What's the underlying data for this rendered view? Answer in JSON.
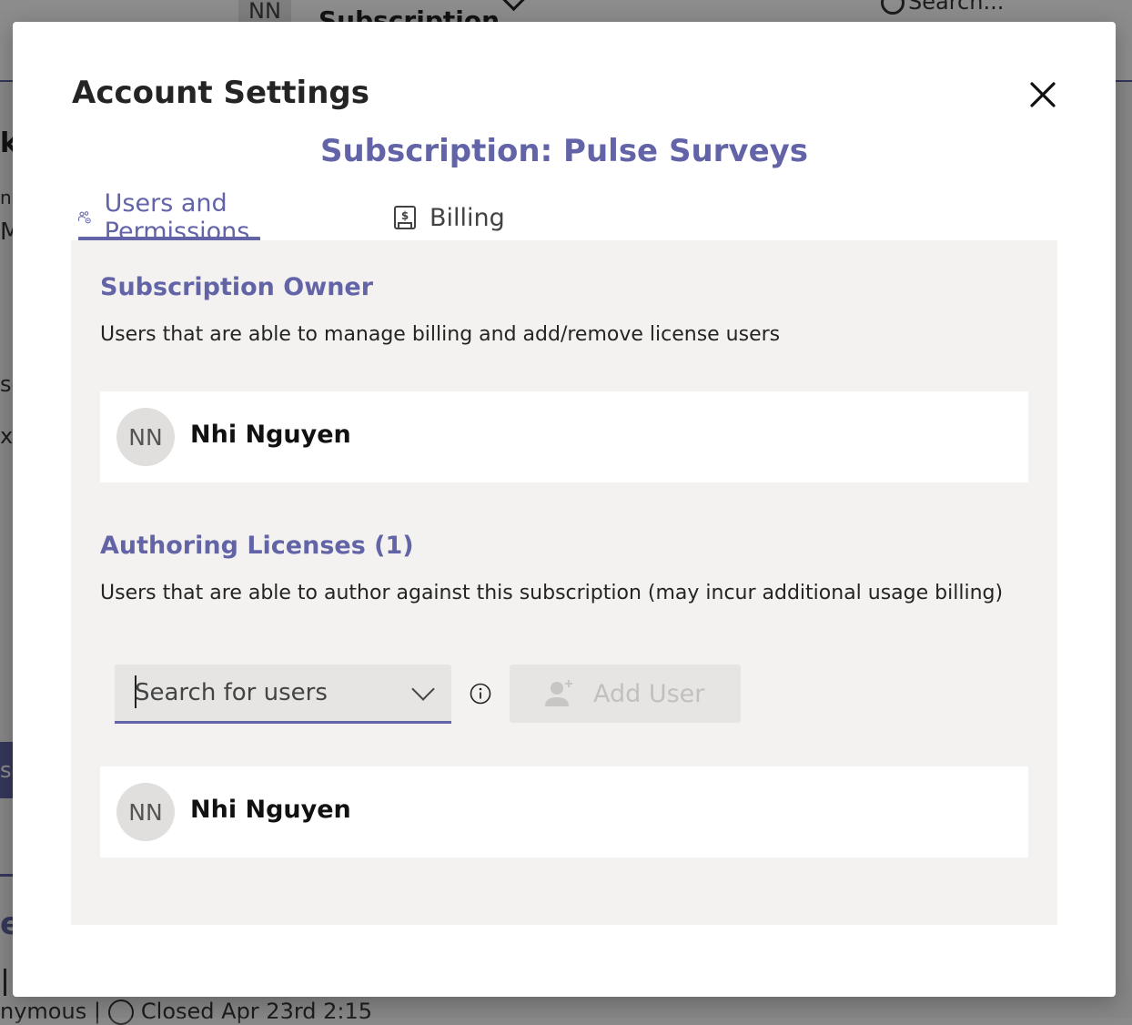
{
  "background": {
    "avatar_initials": "NN",
    "title_fragment": "Subscription",
    "search_text": "Search...",
    "left_fragments": [
      "k",
      "n",
      "M",
      "se",
      "xt"
    ],
    "button_fragment": "se",
    "heading_fragment": "ey",
    "bottom_text": "nymous |",
    "bottom_time": "Closed Apr 23rd 2:15"
  },
  "modal": {
    "title": "Account Settings",
    "subtitle": "Subscription: Pulse Surveys",
    "close_icon": "close-icon"
  },
  "tabs": [
    {
      "label": "Users and Permissions",
      "icon": "users-settings-icon",
      "selected": true
    },
    {
      "label": "Billing",
      "icon": "billing-receipt-icon",
      "selected": false
    }
  ],
  "owner_section": {
    "title": "Subscription Owner",
    "description": "Users that are able to manage billing and add/remove license users",
    "users": [
      {
        "initials": "NN",
        "name": "Nhi Nguyen"
      }
    ]
  },
  "licenses_section": {
    "title": "Authoring Licenses (1)",
    "description": "Users that are able to author against this subscription (may incur additional usage billing)",
    "search_placeholder": "Search for users",
    "add_button_label": "Add User",
    "add_button_disabled": true,
    "users": [
      {
        "initials": "NN",
        "name": "Nhi Nguyen"
      }
    ]
  },
  "colors": {
    "accent": "#6264a7",
    "panel": "#f3f2f1",
    "overlay": "rgba(0,0,0,0.45)"
  }
}
